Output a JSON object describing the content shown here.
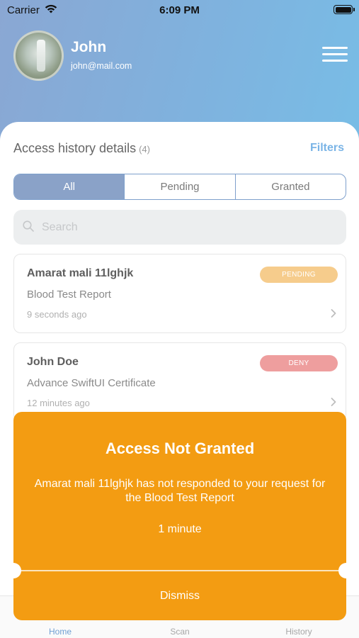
{
  "status_bar": {
    "carrier": "Carrier",
    "time": "6:09 PM"
  },
  "profile": {
    "name": "John",
    "email": "john@mail.com"
  },
  "section": {
    "title": "Access history details",
    "count": "(4)",
    "filters_label": "Filters"
  },
  "segments": [
    {
      "label": "All",
      "selected": true
    },
    {
      "label": "Pending",
      "selected": false
    },
    {
      "label": "Granted",
      "selected": false
    }
  ],
  "search": {
    "placeholder": "Search",
    "value": ""
  },
  "items": [
    {
      "name": "Amarat mali 11lghjk",
      "document": "Blood Test Report",
      "time": "9 seconds ago",
      "status": "PENDING",
      "status_color": "#f6cc8c"
    },
    {
      "name": "John Doe",
      "document": "Advance SwiftUI Certificate",
      "time": "12 minutes ago",
      "status": "DENY",
      "status_color": "#ee9e9e"
    }
  ],
  "toast": {
    "title": "Access Not Granted",
    "message": "Amarat mali 11lghjk has not responded to your request for the Blood Test Report",
    "duration": "1 minute",
    "dismiss_label": "Dismiss",
    "background_color": "#f39c12"
  },
  "tabbar": {
    "tabs": [
      {
        "label": "Home",
        "active": true
      },
      {
        "label": "Scan",
        "active": false
      },
      {
        "label": "History",
        "active": false
      }
    ]
  },
  "colors": {
    "accent": "#7ab4e6",
    "segment_selected": "#8aa2c8",
    "header_gradient_start": "#8aa7d3",
    "header_gradient_end": "#78bde6"
  }
}
